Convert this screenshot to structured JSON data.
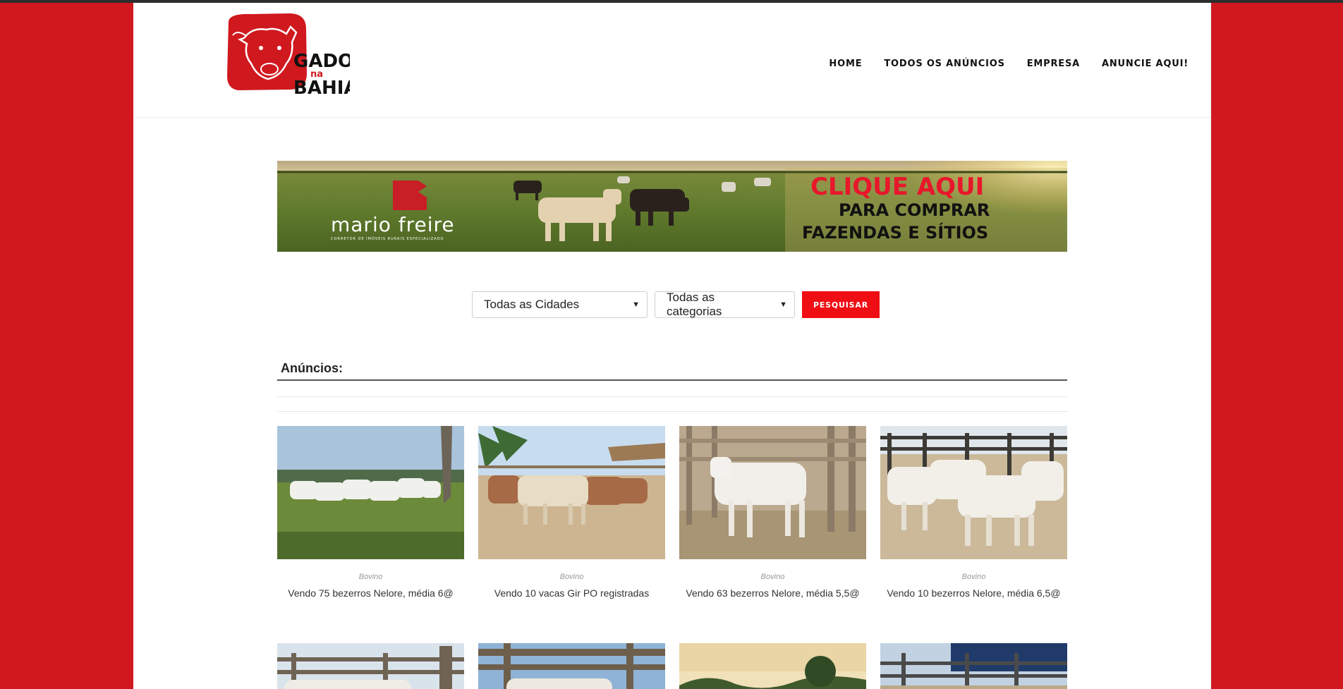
{
  "logo": {
    "line1": "GADO",
    "mid": "na",
    "line2": "BAHIA"
  },
  "nav": [
    {
      "label": "HOME"
    },
    {
      "label": "TODOS OS ANÚNCIOS"
    },
    {
      "label": "EMPRESA"
    },
    {
      "label": "ANUNCIE AQUI!"
    }
  ],
  "banner": {
    "brand": "mario freire",
    "tagline": "CORRETOR DE IMÓVEIS RURAIS ESPECIALIZADO",
    "cta1": "CLIQUE AQUI",
    "cta2": "PARA COMPRAR",
    "cta3": "FAZENDAS E SÍTIOS"
  },
  "search": {
    "city_selected": "Todas as Cidades",
    "category_selected": "Todas as categorias",
    "button_label": "PESQUISAR"
  },
  "section_title": "Anúncios:",
  "listings": [
    {
      "category": "Bovino",
      "title": "Vendo 75 bezerros Nelore, média 6@"
    },
    {
      "category": "Bovino",
      "title": "Vendo 10 vacas Gir PO registradas"
    },
    {
      "category": "Bovino",
      "title": "Vendo 63 bezerros Nelore, média 5,5@"
    },
    {
      "category": "Bovino",
      "title": "Vendo 10 bezerros Nelore, média 6,5@"
    }
  ],
  "colors": {
    "brand_red": "#d0191f",
    "button_red": "#ef0e14"
  }
}
